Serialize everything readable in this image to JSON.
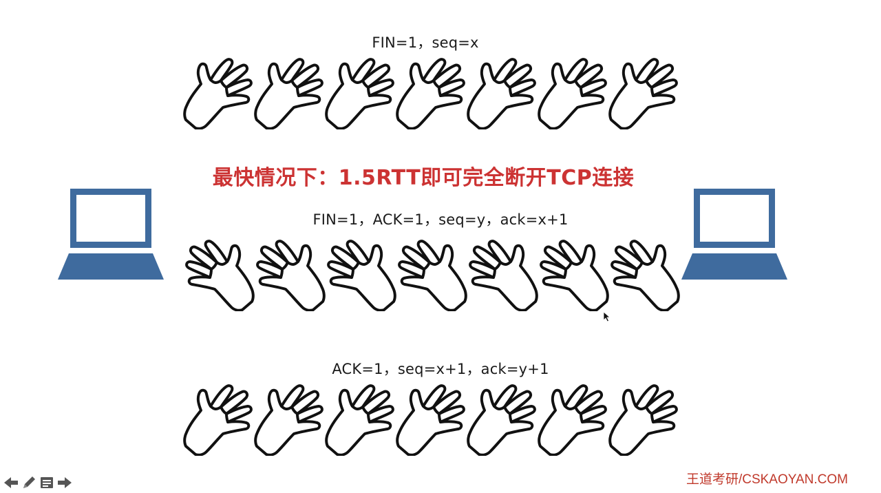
{
  "messages": [
    {
      "label": "FIN=1，seq=x"
    },
    {
      "label": "FIN=1，ACK=1，seq=y，ack=x+1"
    },
    {
      "label": "ACK=1，seq=x+1，ack=y+1"
    }
  ],
  "headline": "最快情况下：1.5RTT即可完全断开TCP连接",
  "watermark": "王道考研/CSKAOYAN.COM",
  "colors": {
    "headline": "#cc3333",
    "laptop": "#3f6b9e",
    "watermark": "#c0392b",
    "nav": "#555555"
  },
  "icons": {
    "laptop": "laptop-icon",
    "hand": "waving-hand-icon",
    "nav": [
      "arrow-left-icon",
      "pen-icon",
      "menu-icon",
      "arrow-right-icon"
    ]
  },
  "hands_per_row": 7,
  "hand_direction": [
    "right",
    "left",
    "right"
  ]
}
